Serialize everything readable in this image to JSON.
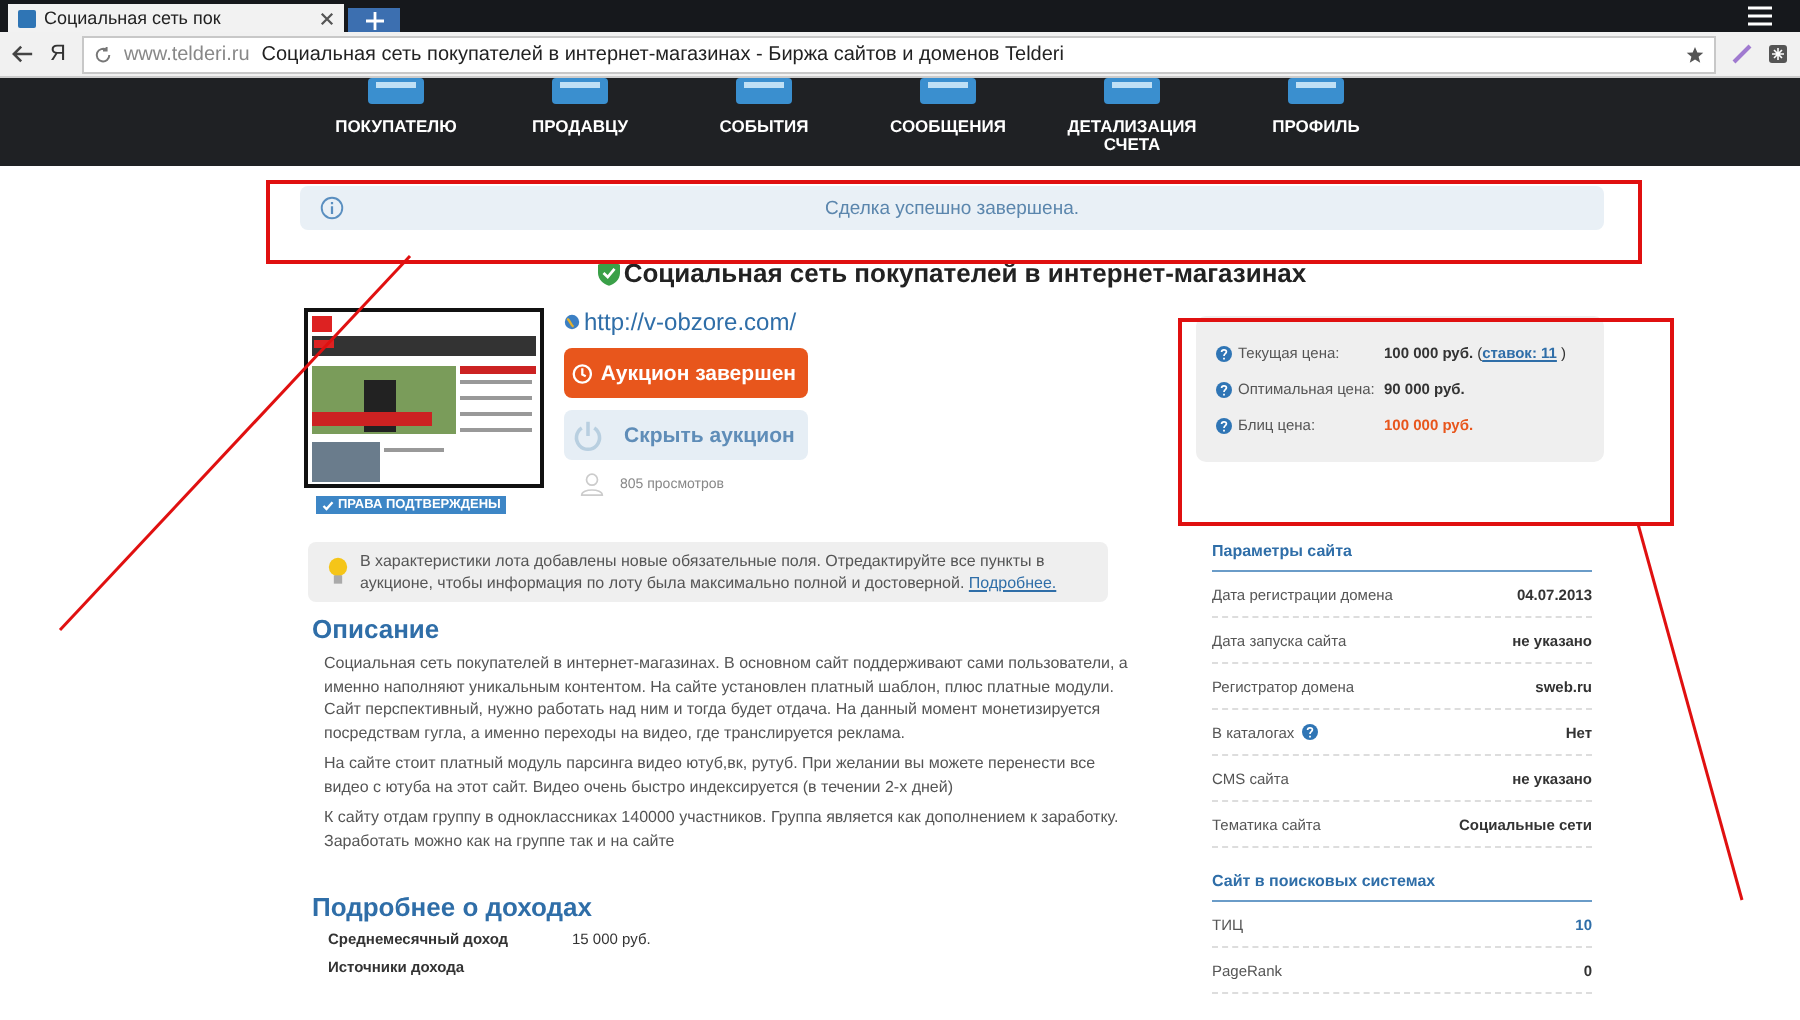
{
  "browser": {
    "tab_title": "Социальная сеть пок",
    "url_domain": "www.telderi.ru",
    "page_title": "Социальная сеть покупателей в интернет-магазинах - Биржа сайтов и доменов Telderi",
    "logo": "Я"
  },
  "nav": [
    {
      "label": "ПОКУПАТЕЛЮ"
    },
    {
      "label": "ПРОДАВЦУ"
    },
    {
      "label": "СОБЫТИЯ"
    },
    {
      "label": "СООБЩЕНИЯ"
    },
    {
      "label": "ДЕТАЛИЗАЦИЯ СЧЕТА"
    },
    {
      "label": "ПРОФИЛЬ"
    }
  ],
  "notice": "Сделка успешно завершена.",
  "title": "Социальная сеть покупателей в интернет-магазинах",
  "lot": {
    "url": "http://v-obzore.com/",
    "status_button": "Аукцион завершен",
    "hide_button": "Скрыть аукцион",
    "rights_badge": "ПРАВА ПОДТВЕРЖДЕНЫ",
    "views": "805 просмотров"
  },
  "hint": {
    "text": "В характеристики лота добавлены новые обязательные поля. Отредактируйте все пункты в аукционе, чтобы информация по лоту была максимально полной и достоверной.",
    "link": "Подробнее."
  },
  "description": {
    "heading": "Описание",
    "paragraphs": [
      "Социальная сеть покупателей в интернет-магазинах. В основном сайт поддерживают сами пользователи, а именно наполняют уникальным контентом. На сайте установлен платный шаблон, плюс платные модули. Сайт перспективный, нужно работать над ним и тогда будет отдача. На данный момент монетизируется посредствам гугла, а именно переходы на видео, где транслируется реклама.",
      "На сайте стоит платный модуль парсинга видео ютуб,вк, рутуб. При желании вы можете перенести все видео с ютуба на этот сайт. Видео очень быстро индексируется (в течении 2-х дней)",
      "К сайту отдам группу в одноклассниках 140000 участников. Группа является как дополнением к заработку. Заработать можно как на группе так и на сайте"
    ]
  },
  "income": {
    "heading": "Подробнее о доходах",
    "rows": [
      {
        "label": "Среднемесячный доход",
        "value": "15 000 руб."
      },
      {
        "label": "Источники дохода"
      }
    ]
  },
  "prices": [
    {
      "label": "Текущая цена:",
      "value": "100 000 руб.",
      "kind": "normal",
      "link_open": "(",
      "link": "ставок: 11",
      "link_close": ")"
    },
    {
      "label": "Оптимальная цена:",
      "value": "90 000 руб.",
      "kind": "normal"
    },
    {
      "label": "Блиц цена:",
      "value": "100 000 руб.",
      "kind": "blitz"
    }
  ],
  "params": {
    "heading": "Параметры сайта",
    "rows": [
      {
        "label": "Дата регистрации домена",
        "value": "04.07.2013",
        "help": false
      },
      {
        "label": "Дата запуска сайта",
        "value": "не указано",
        "help": false
      },
      {
        "label": "Регистратор домена",
        "value": "sweb.ru",
        "help": false
      },
      {
        "label": "В каталогах",
        "value": "Нет",
        "help": true
      },
      {
        "label": "CMS сайта",
        "value": "не указано",
        "help": false
      },
      {
        "label": "Тематика сайта",
        "value": "Социальные сети",
        "help": false
      }
    ]
  },
  "search": {
    "heading": "Сайт в поисковых системах",
    "rows": [
      {
        "label": "ТИЦ",
        "value": "10",
        "link": true
      },
      {
        "label": "PageRank",
        "value": "0",
        "link": false
      }
    ]
  }
}
